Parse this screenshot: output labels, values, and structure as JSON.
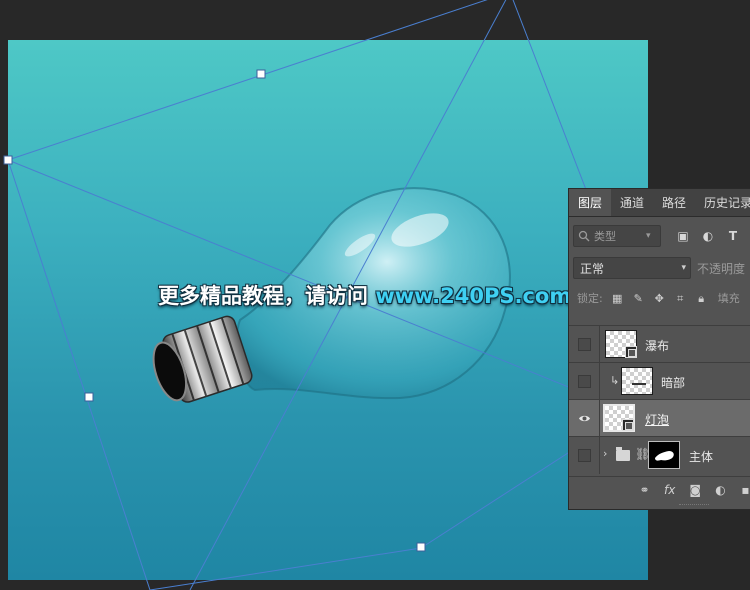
{
  "watermark": {
    "cn": "更多精品教程，请访问",
    "url": "www.240PS.com"
  },
  "panel": {
    "tabs": [
      "图层",
      "通道",
      "路径",
      "历史记录"
    ],
    "kind_select": "类型",
    "blend_mode": "正常",
    "opacity_label": "不透明度",
    "lock_label": "锁定:",
    "fill_label": "填充",
    "layers": [
      {
        "name": "瀑布",
        "visible": false,
        "selected": false,
        "clipped": false
      },
      {
        "name": "暗部",
        "visible": false,
        "selected": false,
        "clipped": true
      },
      {
        "name": "灯泡",
        "visible": true,
        "selected": true,
        "clipped": false
      },
      {
        "name": "主体",
        "visible": false,
        "selected": false,
        "group": true
      }
    ]
  },
  "colors": {
    "canvas_top": "#4ec8c6",
    "canvas_bottom": "#1f86a4",
    "panel_bg": "#535353",
    "workspace_bg": "#282828",
    "url_accent": "#3fd0f2"
  }
}
